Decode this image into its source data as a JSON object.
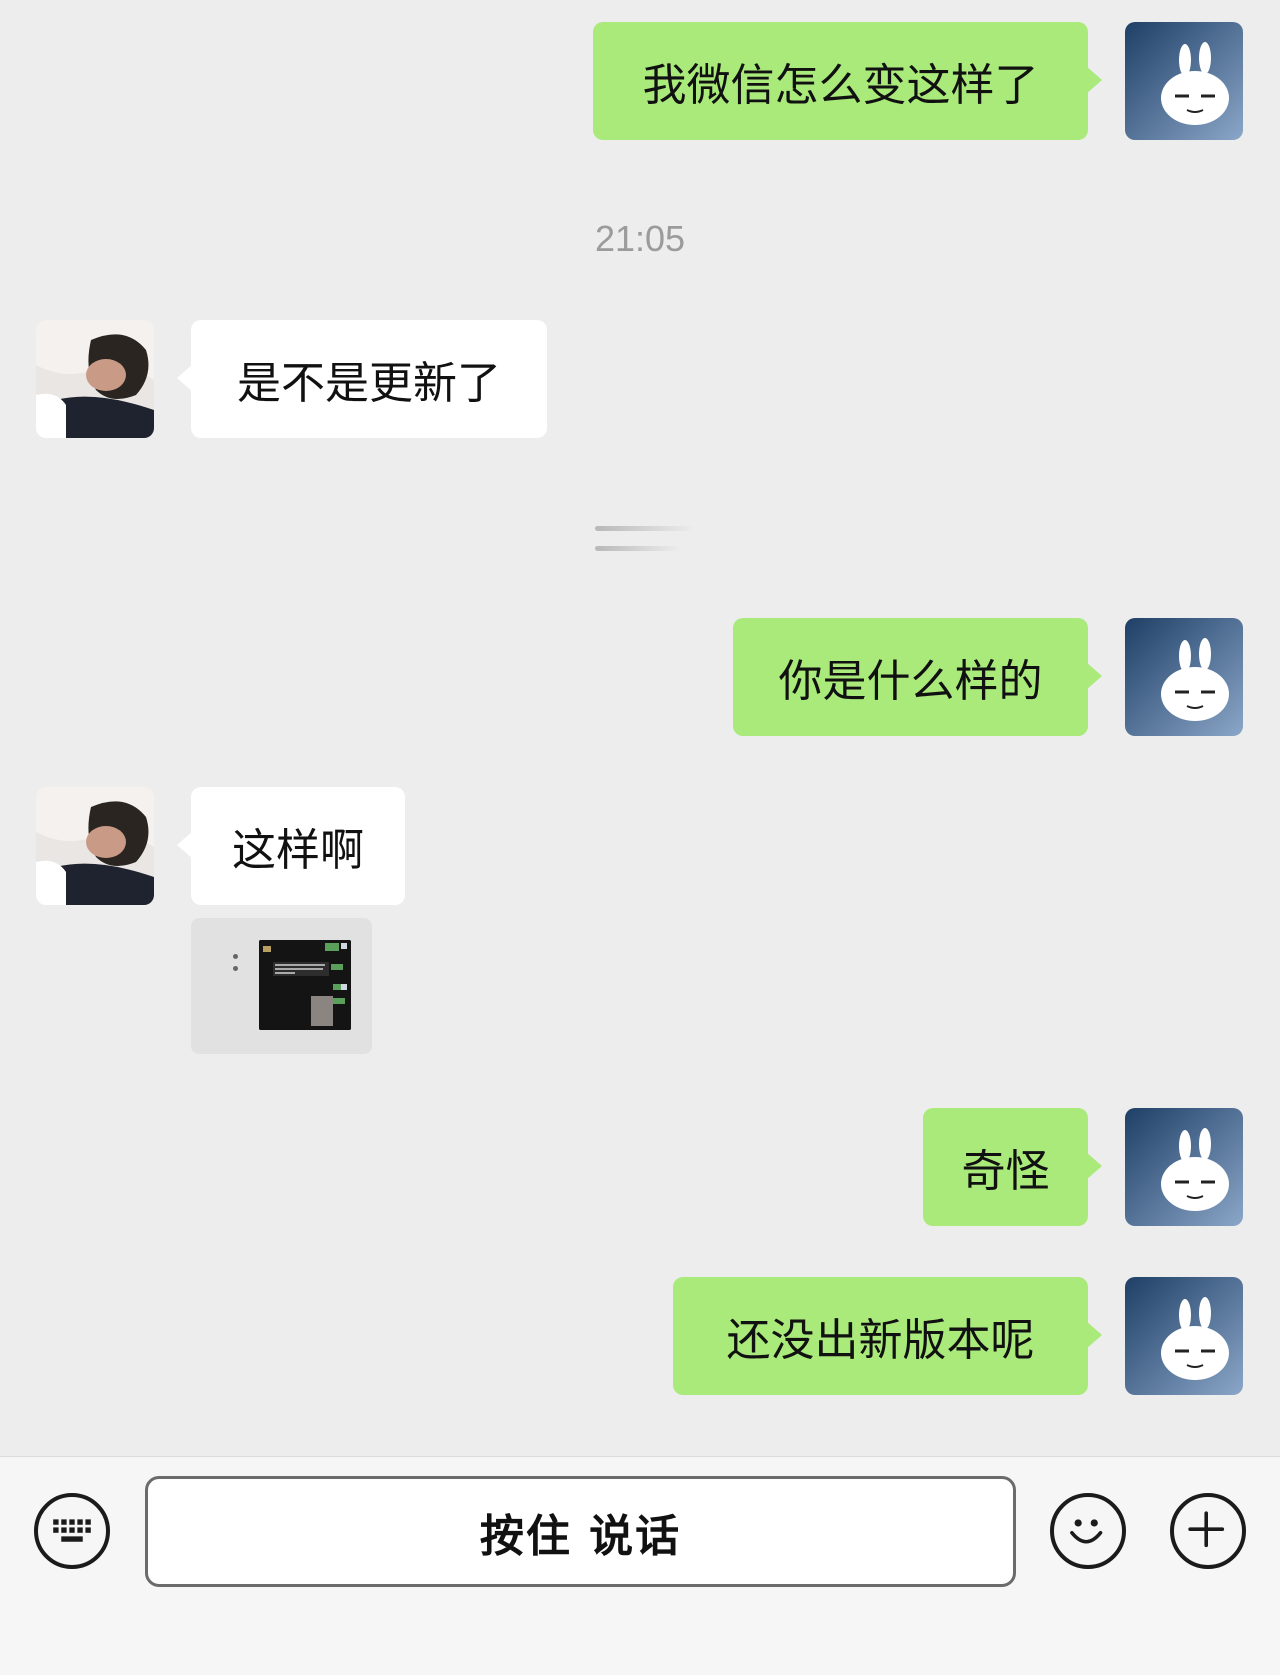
{
  "timestamp": "21:05",
  "messages": [
    {
      "sender": "me",
      "text": "我微信怎么变这样了"
    },
    {
      "sender": "them",
      "text": "是不是更新了"
    },
    {
      "sender": "me",
      "text": "你是什么样的"
    },
    {
      "sender": "them",
      "text": "这样啊"
    },
    {
      "sender": "me",
      "text": "奇怪"
    },
    {
      "sender": "me",
      "text": "还没出新版本呢"
    }
  ],
  "input_bar": {
    "voice_button_label": "按住 说话",
    "left_icon": "keyboard-icon",
    "emoji_icon": "smiley-icon",
    "more_icon": "plus-icon"
  },
  "colors": {
    "background": "#ededed",
    "my_bubble": "#a9ea7a",
    "their_bubble": "#ffffff",
    "timestamp": "#9b9b9b"
  }
}
